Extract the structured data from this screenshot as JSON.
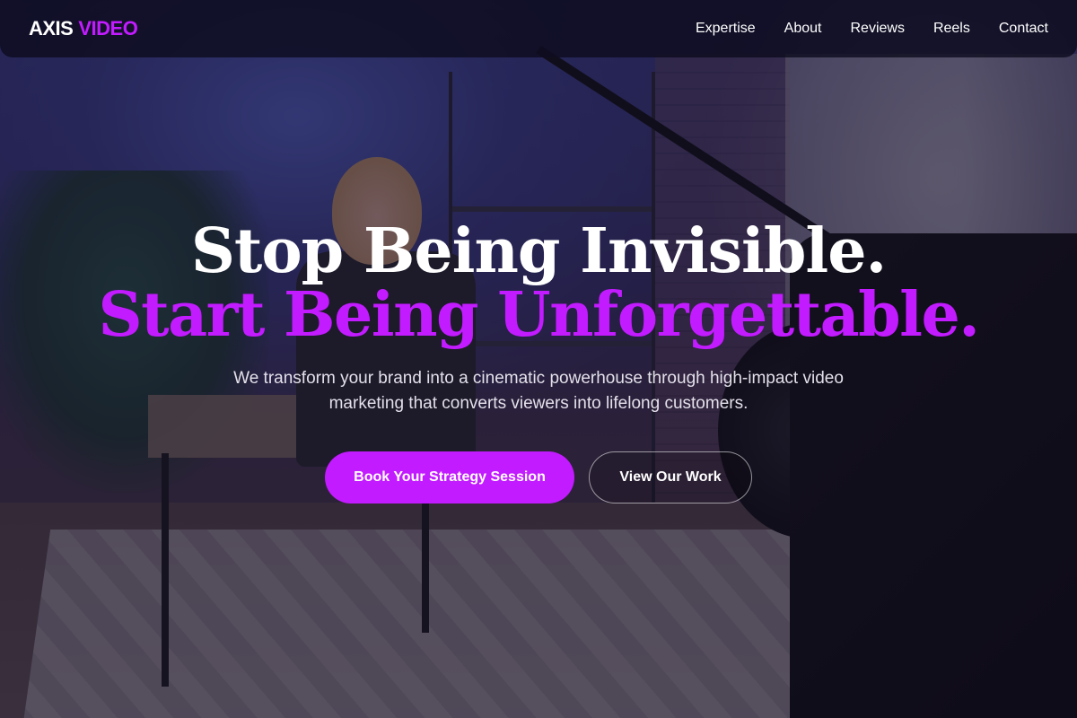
{
  "brand": {
    "name_part1": "AXIS",
    "name_part2": "VIDEO",
    "accent_color": "#c21bff"
  },
  "nav": {
    "items": [
      {
        "label": "Expertise"
      },
      {
        "label": "About"
      },
      {
        "label": "Reviews"
      },
      {
        "label": "Reels"
      },
      {
        "label": "Contact"
      }
    ]
  },
  "hero": {
    "headline_line1": "Stop Being Invisible.",
    "headline_line2": "Start Being Unforgettable.",
    "subtext": "We transform your brand into a cinematic powerhouse through high-impact video marketing that converts viewers into lifelong customers.",
    "primary_cta": "Book Your Strategy Session",
    "secondary_cta": "View Our Work",
    "background": "video studio photo with presenter at desk and cinema camera"
  }
}
